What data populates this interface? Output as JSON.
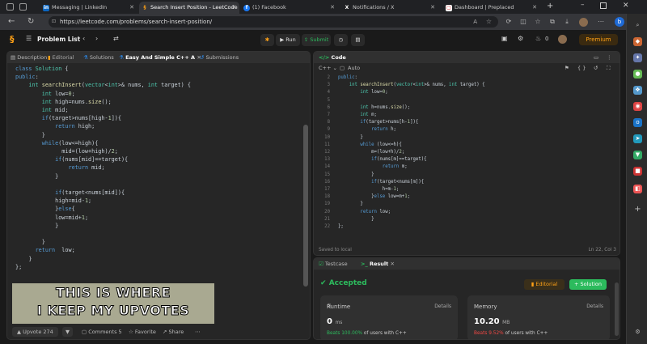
{
  "browser": {
    "tabs": [
      {
        "label": "Messaging | LinkedIn",
        "icon": "linkedin-icon"
      },
      {
        "label": "Search Insert Position - LeetCode",
        "icon": "leetcode-icon"
      },
      {
        "label": "(1) Facebook",
        "icon": "facebook-icon"
      },
      {
        "label": "Notifications / X",
        "icon": "x-icon"
      },
      {
        "label": "Dashboard | Preplaced",
        "icon": "preplaced-icon"
      }
    ],
    "url": "https://leetcode.com/problems/search-insert-position/"
  },
  "header": {
    "problem_list": "Problem List",
    "run": "Run",
    "submit": "Submit",
    "fire_count": "0",
    "premium": "Premium"
  },
  "left_tabs": [
    "Description",
    "Editorial",
    "Solutions",
    "Easy And Simple C++ A",
    "Submissions"
  ],
  "solution_code": [
    "class Solution {",
    "public:",
    "    int searchInsert(vector<int>& nums, int target) {",
    "        int low=0;",
    "        int high=nums.size();",
    "        int mid;",
    "        if(target>nums[high-1]){",
    "            return high;",
    "        }",
    "        while(low<=high){",
    "              mid=(low+high)/2;",
    "            if(nums[mid]==target){",
    "                return mid;",
    "            }",
    "",
    "            if(target<nums[mid]){",
    "            high=mid-1;",
    "            }else{",
    "            low=mid+1;",
    "            }",
    "",
    "        }",
    "      return  low;",
    "    }",
    "};"
  ],
  "meme_text": [
    "THIS IS WHERE",
    "I KEEP MY UPVOTES"
  ],
  "left_footer": {
    "upvote": "Upvote 274",
    "comments": "Comments 5",
    "favorite": "Favorite",
    "share": "Share"
  },
  "code_panel": {
    "title": "Code",
    "language": "C++",
    "auto": "Auto",
    "status": "Saved to local",
    "cursor": "Ln 22, Col 3",
    "line_numbers": [
      "2",
      "3",
      "4",
      "5",
      "6",
      "7",
      "8",
      "9",
      "10",
      "11",
      "12",
      "13",
      "14",
      "15",
      "16",
      "17",
      "18",
      "19",
      "20",
      "21",
      "22"
    ],
    "lines": [
      "public:",
      "    int searchInsert(vector<int>& nums, int target) {",
      "        int low=0;",
      "",
      "        int h=nums.size();",
      "        int m;",
      "        if(target>nums[h-1]){",
      "            return h;",
      "        }",
      "        while (low<=h){",
      "            m=(low+h)/2;",
      "            if(nums[m]==target){",
      "                return m;",
      "            }",
      "            if(target<nums[m]){",
      "                h=m-1;",
      "            }else low=m+1;",
      "        }",
      "        return low;",
      "            }",
      "};"
    ]
  },
  "result_panel": {
    "testcase_tab": "Testcase",
    "result_tab": "Result",
    "status": "Accepted",
    "editorial": "Editorial",
    "solution": "+ Solution",
    "runtime": {
      "label": "Runtime",
      "details": "Details",
      "value": "0",
      "unit": "ms",
      "beats_pct": "Beats 100.00%",
      "beats_rest": "of users with C++"
    },
    "memory": {
      "label": "Memory",
      "details": "Details",
      "value": "10.20",
      "unit": "MB",
      "beats_pct": "Beats 9.52%",
      "beats_rest": "of users with C++"
    }
  },
  "colors": {
    "accepted": "#2cbb5d",
    "premium": "#ffa116",
    "low_beats": "#ef4743"
  }
}
